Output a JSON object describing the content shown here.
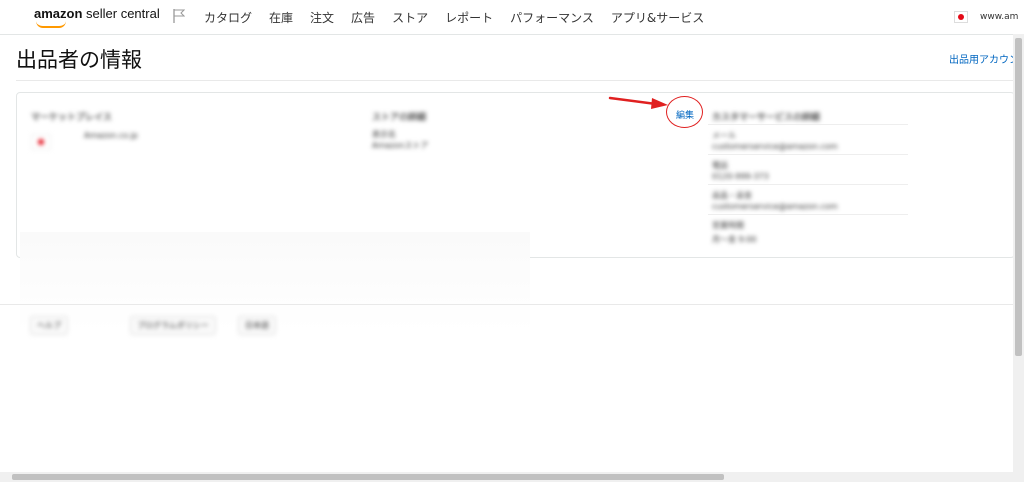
{
  "brand": {
    "logo_bold": "amazon",
    "logo_rest": " seller central"
  },
  "nav": {
    "items": [
      "カタログ",
      "在庫",
      "注文",
      "広告",
      "ストア",
      "レポート",
      "パフォーマンス",
      "アプリ&サービス"
    ]
  },
  "locale": {
    "site": "www.am"
  },
  "page": {
    "title": "出品者の情報",
    "account_link": "出品用アカウン"
  },
  "card": {
    "marketplace_header": "マーケットプレイス",
    "marketplace_value": "Amazon.co.jp",
    "store_header": "ストアの詳細",
    "store_label": "表示名",
    "store_value": "Amazonストア",
    "edit_label": "編集",
    "contact_header": "カスタマーサービスの詳細",
    "contact_lines": [
      "メール",
      "customerservice@amazon.com",
      "電話",
      "0120-999-373",
      "返品・返金",
      "customerservice@amazon.com",
      "営業時間",
      "月〜金 9:00"
    ]
  },
  "footer": {
    "buttons": [
      "ヘルプ",
      "プログラムポリシー",
      "日本語"
    ]
  },
  "colors": {
    "link": "#0066c0",
    "annotation": "#e02020",
    "logo_accent": "#ff9900"
  }
}
